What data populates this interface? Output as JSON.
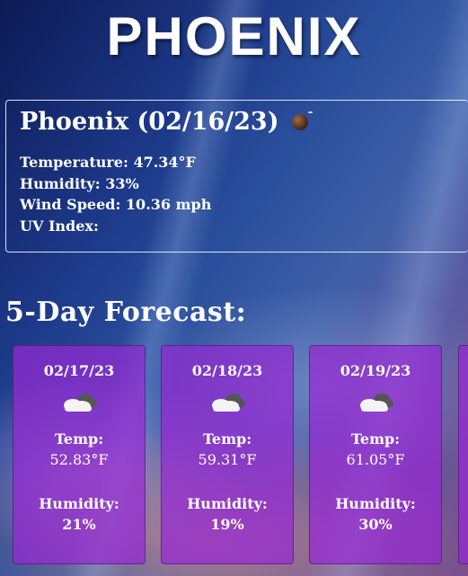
{
  "app": {
    "title": "PHOENIX"
  },
  "current": {
    "heading": "Phoenix (02/16/23)",
    "icon": "bomb-icon",
    "temperature": "Temperature: 47.34°F",
    "humidity": "Humidity: 33%",
    "wind_speed": "Wind Speed: 10.36 mph",
    "uv_index": "UV Index:"
  },
  "forecast": {
    "heading": "5-Day Forecast:",
    "days": [
      {
        "date": "02/17/23",
        "icon": "cloud-icon",
        "temp_label": "Temp:",
        "temp": "52.83°F",
        "humidity_label": "Humidity:",
        "humidity": "21%"
      },
      {
        "date": "02/18/23",
        "icon": "cloud-icon",
        "temp_label": "Temp:",
        "temp": "59.31°F",
        "humidity_label": "Humidity:",
        "humidity": "19%"
      },
      {
        "date": "02/19/23",
        "icon": "cloud-icon",
        "temp_label": "Temp:",
        "temp": "61.05°F",
        "humidity_label": "Humidity:",
        "humidity": "30%"
      }
    ]
  },
  "colors": {
    "card_bg": "#9628d2",
    "background": "#1d3a8a"
  }
}
